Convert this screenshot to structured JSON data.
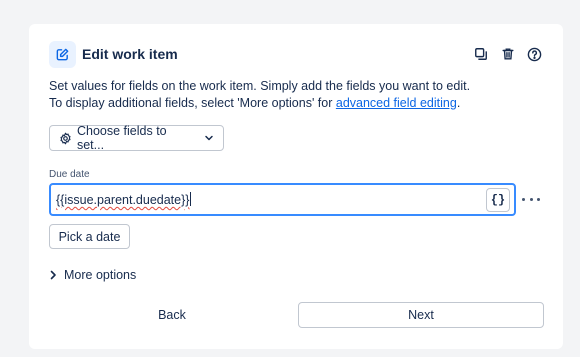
{
  "header": {
    "title": "Edit work item",
    "icon": "pencil-square-icon",
    "actions": [
      "duplicate-icon",
      "trash-icon",
      "help-icon"
    ]
  },
  "description": {
    "line1": "Set values for fields on the work item. Simply add the fields you want to edit.",
    "line2_prefix": "To display additional fields, select 'More options' for ",
    "link": "advanced field editing",
    "line2_suffix": "."
  },
  "choose_fields": {
    "label": "Choose fields to set...",
    "icon": "gear-icon"
  },
  "due_date": {
    "label": "Due date",
    "value": "{{issue.parent.duedate}}",
    "smart_value_button": "{}"
  },
  "pick_date_label": "Pick a date",
  "more_options_label": "More options",
  "footer": {
    "back_label": "Back",
    "next_label": "Next"
  },
  "colors": {
    "accent": "#388bff",
    "link": "#0c66e4",
    "text": "#172b4d",
    "background": "#f3f4f6"
  }
}
